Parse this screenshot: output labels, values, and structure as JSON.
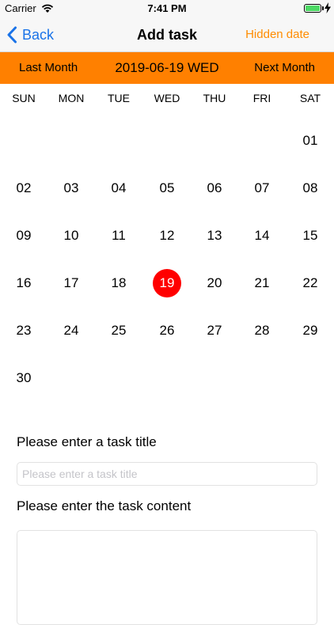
{
  "status_bar": {
    "carrier": "Carrier",
    "time": "7:41 PM",
    "battery_level": 1.0,
    "battery_color": "#4cd964"
  },
  "nav": {
    "back_label": "Back",
    "title": "Add task",
    "hidden_date_label": "Hidden date",
    "accent_color": "#1a73e8",
    "action_color": "#ff8c00"
  },
  "month_bar": {
    "last_month_label": "Last Month",
    "current_date": "2019-06-19 WED",
    "next_month_label": "Next Month",
    "background_color": "#ff8000"
  },
  "calendar": {
    "weekdays": [
      "SUN",
      "MON",
      "TUE",
      "WED",
      "THU",
      "FRI",
      "SAT"
    ],
    "first_weekday_index": 6,
    "days": [
      "01",
      "02",
      "03",
      "04",
      "05",
      "06",
      "07",
      "08",
      "09",
      "10",
      "11",
      "12",
      "13",
      "14",
      "15",
      "16",
      "17",
      "18",
      "19",
      "20",
      "21",
      "22",
      "23",
      "24",
      "25",
      "26",
      "27",
      "28",
      "29",
      "30"
    ],
    "selected_day": "19",
    "selected_color": "#ff0000"
  },
  "form": {
    "title_label": "Please enter a task title",
    "title_value": "",
    "title_placeholder": "Please enter a task title",
    "content_label": "Please enter the task content",
    "content_value": ""
  }
}
